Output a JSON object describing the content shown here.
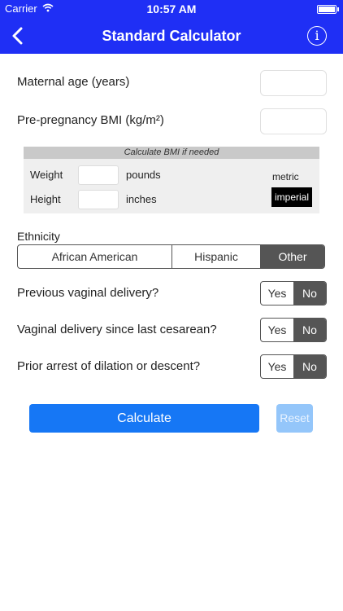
{
  "status": {
    "carrier": "Carrier",
    "time": "10:57 AM"
  },
  "nav": {
    "title": "Standard Calculator",
    "info_glyph": "i"
  },
  "fields": {
    "maternal_age": {
      "label": "Maternal age (years)",
      "value": ""
    },
    "bmi": {
      "label": "Pre-pregnancy BMI (kg/m²)",
      "value": ""
    }
  },
  "bmi_calc": {
    "header": "Calculate BMI if needed",
    "weight_label": "Weight",
    "weight_unit": "pounds",
    "height_label": "Height",
    "height_unit": "inches",
    "metric_label": "metric",
    "imperial_label": "imperial",
    "selected_unit": "imperial"
  },
  "ethnicity": {
    "label": "Ethnicity",
    "options": [
      "African American",
      "Hispanic",
      "Other"
    ],
    "selected": "Other"
  },
  "questions": [
    {
      "label": "Previous vaginal delivery?",
      "yes": "Yes",
      "no": "No",
      "selected": "No"
    },
    {
      "label": "Vaginal delivery since last cesarean?",
      "yes": "Yes",
      "no": "No",
      "selected": "No"
    },
    {
      "label": "Prior arrest of dilation or descent?",
      "yes": "Yes",
      "no": "No",
      "selected": "No"
    }
  ],
  "buttons": {
    "calculate": "Calculate",
    "reset": "Reset"
  },
  "colors": {
    "header": "#1f2ff5",
    "primary_button": "#1677f5",
    "reset_button": "#94c6fa",
    "selected_segment": "#555555"
  }
}
